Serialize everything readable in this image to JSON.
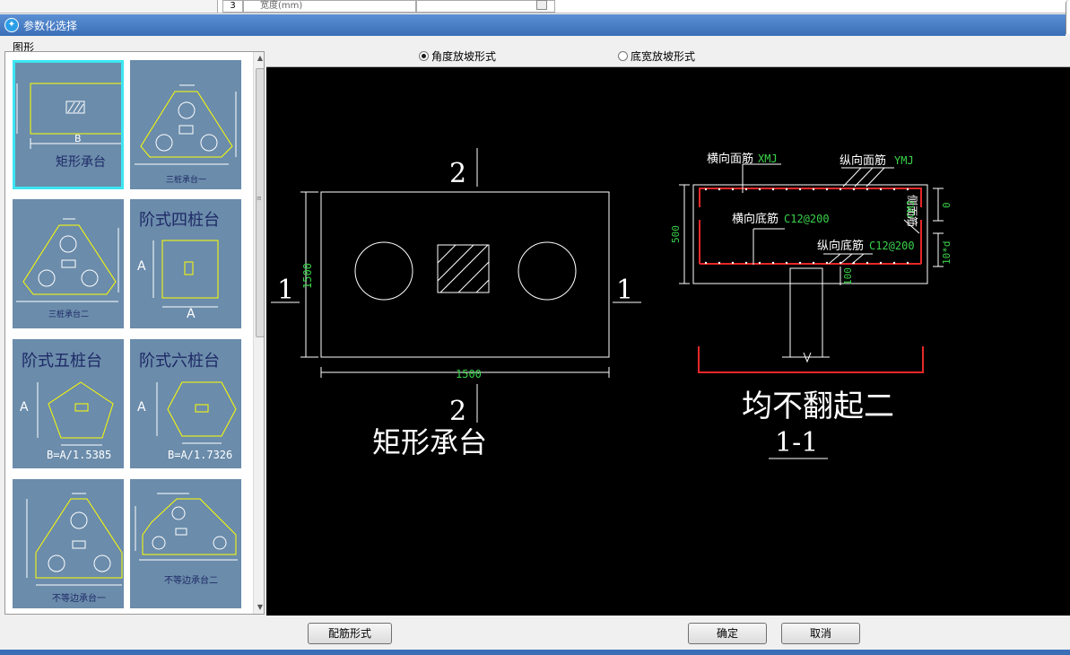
{
  "background_table": {
    "row_number": "3",
    "row_name": "宽度(mm)"
  },
  "dialog": {
    "title": "参数化选择",
    "shapes_group_label": "图形",
    "radio_options": [
      {
        "label": "角度放坡形式",
        "selected": true
      },
      {
        "label": "底宽放坡形式",
        "selected": false
      }
    ],
    "buttons": {
      "rebar_form": "配筋形式",
      "ok": "确定",
      "cancel": "取消"
    }
  },
  "thumbnails": [
    {
      "label": "矩形承台",
      "selected": true,
      "dim_labels": [
        "B"
      ]
    },
    {
      "label": "三桩承台一",
      "selected": false
    },
    {
      "label": "三桩承台二",
      "selected": false
    },
    {
      "label": "阶式四桩台",
      "selected": false,
      "dim_labels": [
        "A",
        "A"
      ]
    },
    {
      "label": "阶式五桩台",
      "selected": false,
      "dim_labels": [
        "A",
        "B=A/1.5385"
      ]
    },
    {
      "label": "阶式六桩台",
      "selected": false,
      "dim_labels": [
        "A",
        "B=A/1.7326"
      ]
    },
    {
      "label": "不等边承台一",
      "selected": false
    },
    {
      "label": "不等边承台二",
      "selected": false
    }
  ],
  "drawing": {
    "plan": {
      "section_marks": [
        "2",
        "2",
        "1",
        "1"
      ],
      "width_dim": "1500",
      "height_dim": "1500",
      "caption": "矩形承台"
    },
    "section": {
      "top_transverse_label": "横向面筋",
      "top_transverse_code": "XMJ",
      "top_longitudinal_label": "纵向面筋",
      "top_longitudinal_code": "YMJ",
      "bottom_transverse_label": "横向底筋",
      "bottom_transverse_code": "C12@200",
      "bottom_longitudinal_label": "纵向底筋",
      "bottom_longitudinal_code": "C12@200",
      "side_label": "侧面筋",
      "side_code": "CMJ",
      "height_dim": "500",
      "top_cover": "0",
      "bottom_dim": "10*d",
      "embed_dim": "100",
      "caption": "均不翻起二",
      "section_title": "1-1"
    },
    "colors": {
      "rebar": "#e8282a",
      "code_text": "#3ad44a",
      "lines": "#ffffff",
      "highlight": "#ffff00"
    }
  }
}
